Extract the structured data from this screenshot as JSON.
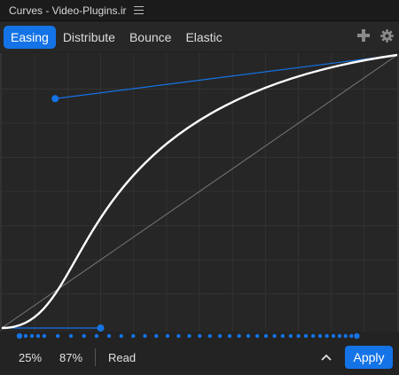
{
  "window": {
    "title": "Curves - Video-Plugins.ir"
  },
  "tabs": [
    {
      "label": "Easing",
      "active": true
    },
    {
      "label": "Distribute",
      "active": false
    },
    {
      "label": "Bounce",
      "active": false
    },
    {
      "label": "Elastic",
      "active": false
    }
  ],
  "toolbar_icons": [
    "plus-icon",
    "gear-icon"
  ],
  "curve_editor": {
    "grid": true,
    "grid_divisions": 12,
    "curve": {
      "start": [
        0,
        0
      ],
      "end": [
        1,
        1
      ],
      "handle_in": [
        0.25,
        0
      ],
      "handle_out": [
        0.87,
        1
      ]
    },
    "colors": {
      "curve": "#ffffff",
      "handle": "#1473e6",
      "diagonal": "#777777",
      "grid": "#333333"
    }
  },
  "status": {
    "handle_in_value": "25%",
    "handle_out_value": "87%",
    "mode": "Read"
  },
  "actions": {
    "apply_label": "Apply"
  },
  "accent_color": "#1473e6"
}
